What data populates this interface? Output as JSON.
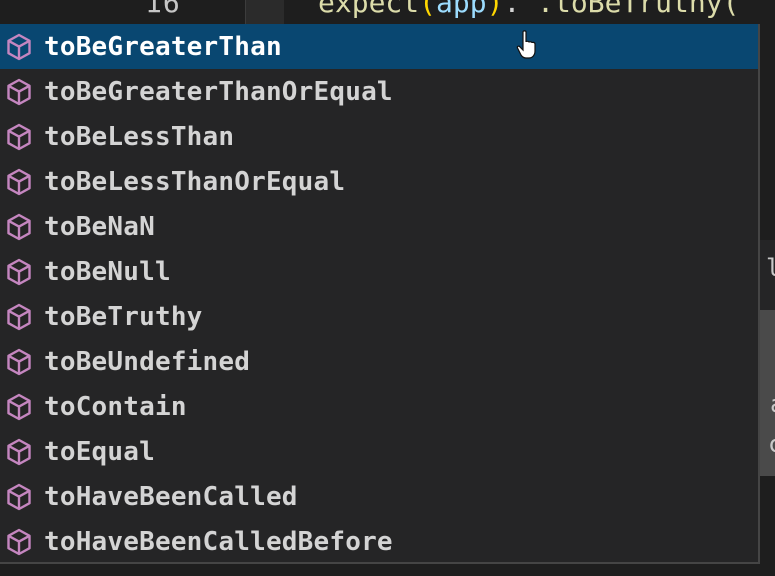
{
  "editor": {
    "line_number": "16",
    "code": {
      "fn": "expect",
      "open_paren": "(",
      "arg": "app",
      "close_paren": ")",
      "dot_space": ". ",
      "method": ".toBeTruthy("
    },
    "side_peek_chars": [
      "l",
      "a",
      "c"
    ]
  },
  "suggest": {
    "selected_index": 0,
    "icon": "method-cube-icon",
    "items": [
      {
        "label": "toBeGreaterThan"
      },
      {
        "label": "toBeGreaterThanOrEqual"
      },
      {
        "label": "toBeLessThan"
      },
      {
        "label": "toBeLessThanOrEqual"
      },
      {
        "label": "toBeNaN"
      },
      {
        "label": "toBeNull"
      },
      {
        "label": "toBeTruthy"
      },
      {
        "label": "toBeUndefined"
      },
      {
        "label": "toContain"
      },
      {
        "label": "toEqual"
      },
      {
        "label": "toHaveBeenCalled"
      },
      {
        "label": "toHaveBeenCalledBefore"
      }
    ]
  },
  "colors": {
    "background": "#1e1e1e",
    "suggest_bg": "#252526",
    "selected_bg": "#094771",
    "icon_purple": "#c586c0",
    "label_text": "#d4d4d4"
  }
}
